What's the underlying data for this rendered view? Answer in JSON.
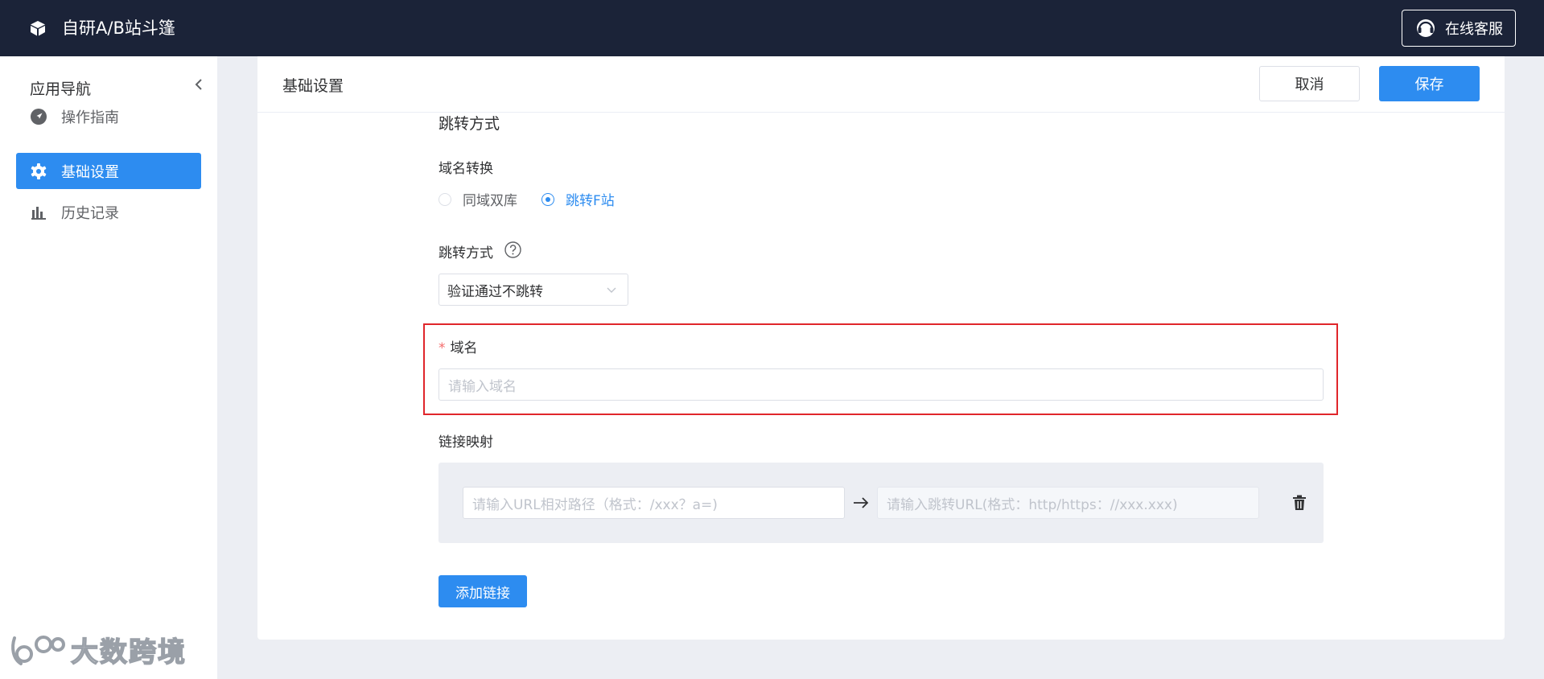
{
  "topbar": {
    "app_title": "自研A/B站斗篷",
    "logo_icon": "cube-icon",
    "support_label": "在线客服",
    "support_icon": "headset-icon"
  },
  "sidebar": {
    "header": "应用导航",
    "collapse_icon": "chevron-left-icon",
    "items": [
      {
        "label": "操作指南",
        "icon": "navigation-arrow-icon",
        "active": false
      },
      {
        "label": "基础设置",
        "icon": "gear-icon",
        "active": true
      },
      {
        "label": "历史记录",
        "icon": "bar-chart-icon",
        "active": false
      }
    ],
    "watermark": "大数跨境"
  },
  "card": {
    "title": "基础设置",
    "cancel_label": "取消",
    "save_label": "保存"
  },
  "form": {
    "section_title": "跳转方式",
    "domain_conversion": {
      "label": "域名转换",
      "options": [
        {
          "label": "同域双库",
          "checked": false
        },
        {
          "label": "跳转F站",
          "checked": true
        }
      ]
    },
    "jump_mode": {
      "label": "跳转方式",
      "help_icon": "question-circle-icon",
      "selected": "验证通过不跳转"
    },
    "domain": {
      "required_mark": "*",
      "label": "域名",
      "placeholder": "请输入域名"
    },
    "link_mapping": {
      "label": "链接映射",
      "source_placeholder": "请输入URL相对路径（格式：/xxx？a=)",
      "target_placeholder": "请输入跳转URL(格式：http/https：//xxx.xxx)",
      "arrow_icon": "arrow-right-icon",
      "delete_icon": "trash-icon"
    },
    "add_link_label": "添加链接"
  },
  "colors": {
    "topbar_bg": "#1b2338",
    "primary": "#2d8cf0",
    "highlight_border": "#e0262b",
    "page_bg": "#eceef3"
  }
}
